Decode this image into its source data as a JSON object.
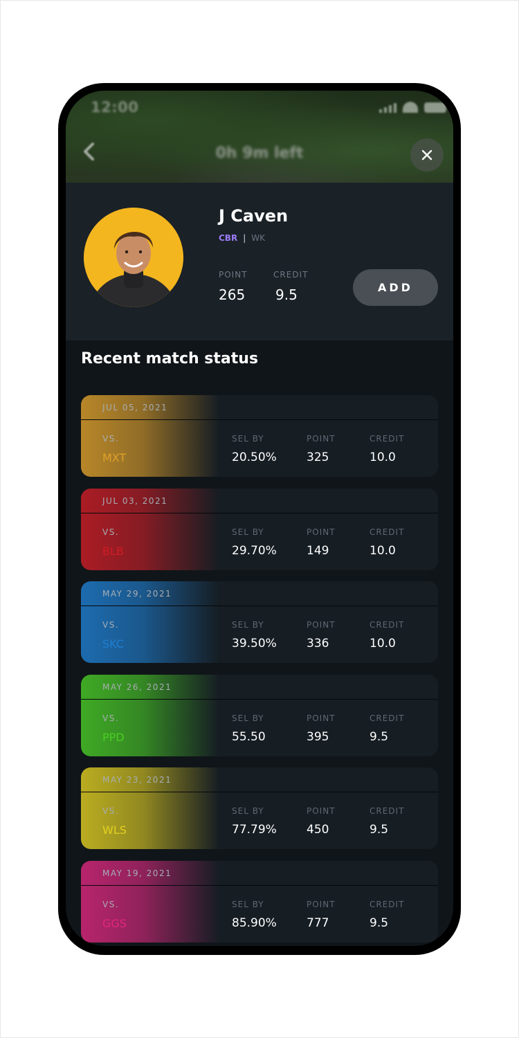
{
  "status_bar": {
    "time": "12:00"
  },
  "header": {
    "timer": "0h 9m left"
  },
  "player": {
    "name": "J Caven",
    "team": "CBR",
    "separator": "|",
    "role": "WK",
    "point_label": "POINT",
    "point_value": "265",
    "credit_label": "CREDIT",
    "credit_value": "9.5",
    "add_label": "ADD"
  },
  "section_title": "Recent match status",
  "columns": {
    "vs": "VS.",
    "sel_by": "SEL BY",
    "point": "POINT",
    "credit": "CREDIT"
  },
  "matches": [
    {
      "date": "JUL 05, 2021",
      "opponent": "MXT",
      "sel_by": "20.50%",
      "point": "325",
      "credit": "10.0",
      "color": "#e0a12a"
    },
    {
      "date": "JUL 03, 2021",
      "opponent": "BLB",
      "sel_by": "29.70%",
      "point": "149",
      "credit": "10.0",
      "color": "#d01c24"
    },
    {
      "date": "MAY 29, 2021",
      "opponent": "SKC",
      "sel_by": "39.50%",
      "point": "336",
      "credit": "10.0",
      "color": "#1e7fd2"
    },
    {
      "date": "MAY 26, 2021",
      "opponent": "PPD",
      "sel_by": "55.50",
      "point": "395",
      "credit": "9.5",
      "color": "#49cd25"
    },
    {
      "date": "MAY 23, 2021",
      "opponent": "WLS",
      "sel_by": "77.79%",
      "point": "450",
      "credit": "9.5",
      "color": "#e3d020"
    },
    {
      "date": "MAY 19, 2021",
      "opponent": "GGS",
      "sel_by": "85.90%",
      "point": "777",
      "credit": "9.5",
      "color": "#e0267f"
    }
  ]
}
